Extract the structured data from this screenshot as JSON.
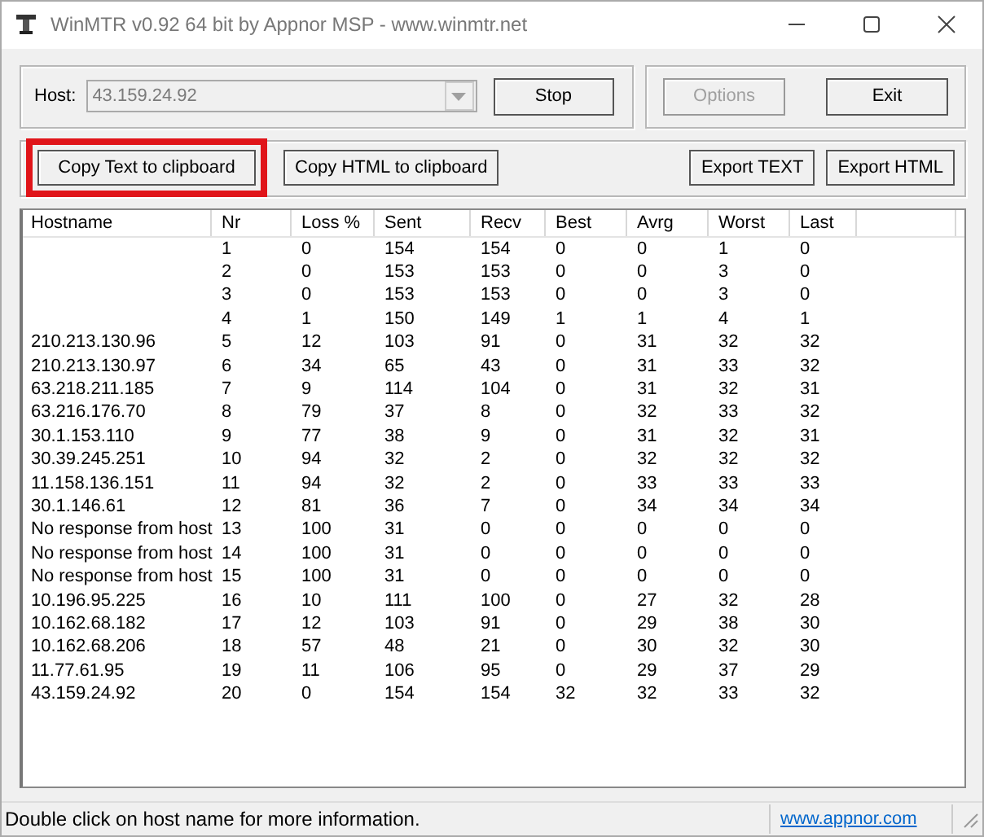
{
  "window": {
    "title": "WinMTR v0.92 64 bit by Appnor MSP - www.winmtr.net"
  },
  "host": {
    "label": "Host:",
    "value": "43.159.24.92",
    "disabled": true
  },
  "top_buttons": [
    {
      "label": "Stop",
      "disabled": false
    },
    {
      "label": "Options",
      "disabled": true
    },
    {
      "label": "Exit",
      "disabled": false
    }
  ],
  "copy_buttons": [
    {
      "label": "Copy Text to clipboard",
      "highlighted": true
    },
    {
      "label": "Copy HTML to clipboard",
      "highlighted": false
    }
  ],
  "export_buttons": [
    "Export TEXT",
    "Export HTML"
  ],
  "table": {
    "columns": [
      "Hostname",
      "Nr",
      "Loss %",
      "Sent",
      "Recv",
      "Best",
      "Avrg",
      "Worst",
      "Last"
    ],
    "rows": [
      [
        "",
        "1",
        "0",
        "154",
        "154",
        "0",
        "0",
        "1",
        "0"
      ],
      [
        "",
        "2",
        "0",
        "153",
        "153",
        "0",
        "0",
        "3",
        "0"
      ],
      [
        "",
        "3",
        "0",
        "153",
        "153",
        "0",
        "0",
        "3",
        "0"
      ],
      [
        "",
        "4",
        "1",
        "150",
        "149",
        "1",
        "1",
        "4",
        "1"
      ],
      [
        "210.213.130.96",
        "5",
        "12",
        "103",
        "91",
        "0",
        "31",
        "32",
        "32"
      ],
      [
        "210.213.130.97",
        "6",
        "34",
        "65",
        "43",
        "0",
        "31",
        "33",
        "32"
      ],
      [
        "63.218.211.185",
        "7",
        "9",
        "114",
        "104",
        "0",
        "31",
        "32",
        "31"
      ],
      [
        "63.216.176.70",
        "8",
        "79",
        "37",
        "8",
        "0",
        "32",
        "33",
        "32"
      ],
      [
        "30.1.153.110",
        "9",
        "77",
        "38",
        "9",
        "0",
        "31",
        "32",
        "31"
      ],
      [
        "30.39.245.251",
        "10",
        "94",
        "32",
        "2",
        "0",
        "32",
        "32",
        "32"
      ],
      [
        "11.158.136.151",
        "11",
        "94",
        "32",
        "2",
        "0",
        "33",
        "33",
        "33"
      ],
      [
        "30.1.146.61",
        "12",
        "81",
        "36",
        "7",
        "0",
        "34",
        "34",
        "34"
      ],
      [
        "No response from host",
        "13",
        "100",
        "31",
        "0",
        "0",
        "0",
        "0",
        "0"
      ],
      [
        "No response from host",
        "14",
        "100",
        "31",
        "0",
        "0",
        "0",
        "0",
        "0"
      ],
      [
        "No response from host",
        "15",
        "100",
        "31",
        "0",
        "0",
        "0",
        "0",
        "0"
      ],
      [
        "10.196.95.225",
        "16",
        "10",
        "111",
        "100",
        "0",
        "27",
        "32",
        "28"
      ],
      [
        "10.162.68.182",
        "17",
        "12",
        "103",
        "91",
        "0",
        "29",
        "38",
        "30"
      ],
      [
        "10.162.68.206",
        "18",
        "57",
        "48",
        "21",
        "0",
        "30",
        "32",
        "30"
      ],
      [
        "11.77.61.95",
        "19",
        "11",
        "106",
        "95",
        "0",
        "29",
        "37",
        "29"
      ],
      [
        "43.159.24.92",
        "20",
        "0",
        "154",
        "154",
        "32",
        "32",
        "33",
        "32"
      ]
    ]
  },
  "status_bar": {
    "message": "Double click on host name for more information.",
    "link": "www.appnor.com"
  }
}
